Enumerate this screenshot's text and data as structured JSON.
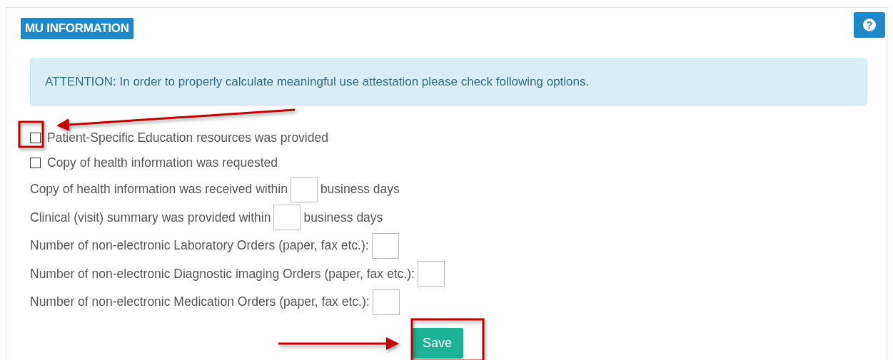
{
  "panel": {
    "title": "MU INFORMATION",
    "help_icon": "?"
  },
  "alert": {
    "text": "ATTENTION: In order to properly calculate meaningful use attestation please check following options."
  },
  "rows": [
    {
      "kind": "checkbox",
      "label": "Patient-Specific Education resources was provided",
      "checked": false
    },
    {
      "kind": "checkbox",
      "label": "Copy of health information was requested",
      "checked": false
    },
    {
      "kind": "field",
      "label": "Copy of health information was received within",
      "suffix": "business days"
    },
    {
      "kind": "field",
      "label": "Clinical (visit) summary was provided within",
      "suffix": "business days"
    },
    {
      "kind": "field",
      "label": "Number of non-electronic Laboratory Orders (paper, fax etc.):"
    },
    {
      "kind": "field",
      "label": "Number of non-electronic Diagnostic imaging Orders (paper, fax etc.):"
    },
    {
      "kind": "field",
      "label": "Number of non-electronic Medication Orders (paper, fax etc.):"
    }
  ],
  "save_button": {
    "label": "Save"
  }
}
